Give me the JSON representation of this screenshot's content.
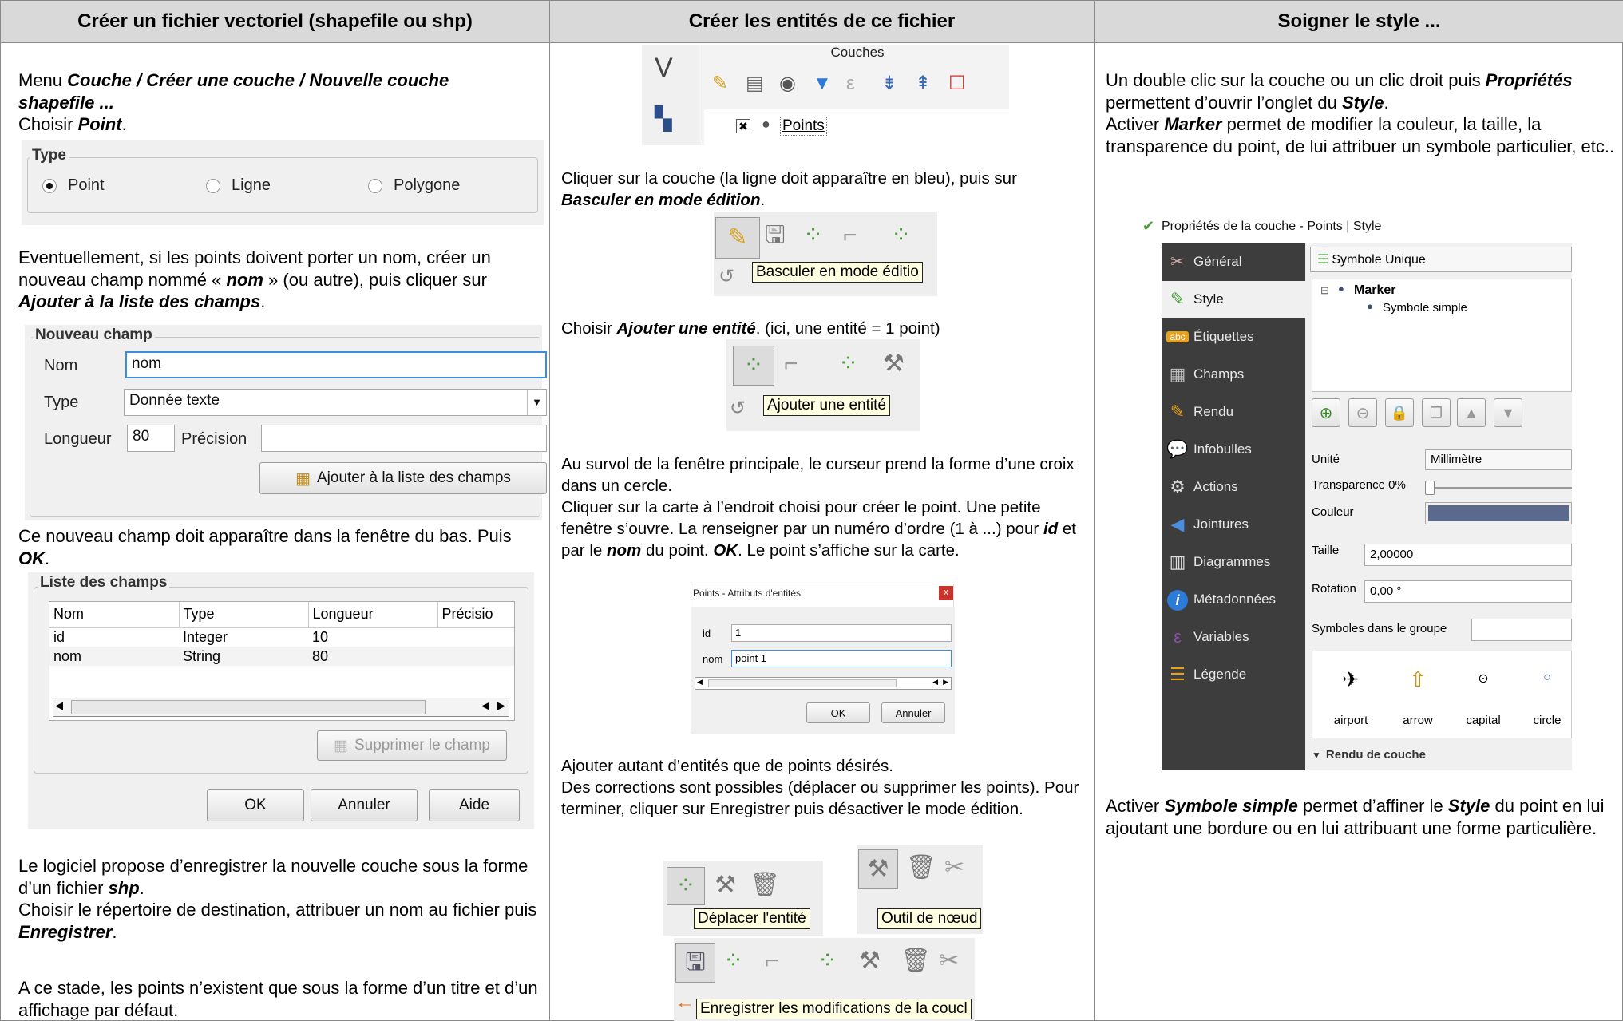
{
  "columns": [
    {
      "title": "Créer un fichier vectoriel (shapefile ou shp)"
    },
    {
      "title": "Créer les entités de ce fichier"
    },
    {
      "title": "Soigner le style ..."
    }
  ],
  "col1": {
    "p1_a": "Menu ",
    "p1_b": "Couche / Créer une couche / Nouvelle couche shapefile ...",
    "p1_c": "Choisir ",
    "p1_d": "Point",
    "p1_e": ".",
    "type_group": {
      "title": "Type",
      "options": [
        "Point",
        "Ligne",
        "Polygone"
      ],
      "selected": "Point"
    },
    "p2_a": "Eventuellement, si les points doivent porter un nom, créer un nouveau champ nommé « ",
    "p2_b": "nom",
    "p2_c": " » (ou autre), puis cliquer sur ",
    "p2_d": "Ajouter à la liste des champs",
    "p2_e": ".",
    "new_field": {
      "title": "Nouveau champ",
      "name_label": "Nom",
      "name_value": "nom",
      "type_label": "Type",
      "type_value": "Donnée texte",
      "length_label": "Longueur",
      "length_value": "80",
      "precision_label": "Précision",
      "precision_value": "",
      "add_button": "Ajouter à la liste des champs"
    },
    "p3_a": "Ce nouveau champ doit apparaître dans la fenêtre du bas. Puis ",
    "p3_b": "OK",
    "p3_c": ".",
    "field_list": {
      "title": "Liste des champs",
      "headers": [
        "Nom",
        "Type",
        "Longueur",
        "Précisio"
      ],
      "rows": [
        [
          "id",
          "Integer",
          "10",
          ""
        ],
        [
          "nom",
          "String",
          "80",
          ""
        ]
      ],
      "delete_button": "Supprimer le champ",
      "ok_button": "OK",
      "cancel_button": "Annuler",
      "help_button": "Aide"
    },
    "p4_a": "Le logiciel propose d’enregistrer la nouvelle couche sous la forme d’un fichier ",
    "p4_b": "shp",
    "p4_c": ".",
    "p4_d": "Choisir le répertoire de destination, attribuer un nom au fichier puis ",
    "p4_e": "Enregistrer",
    "p4_f": ".",
    "p5": "A ce stade, les points n’existent que sous la forme d’un titre et d’un affichage par défaut."
  },
  "col2": {
    "layers_panel": {
      "title": "Couches",
      "layer_name": "Points"
    },
    "p1_a": "Cliquer sur la couche (la ligne doit apparaître en bleu), puis sur ",
    "p1_b": "Basculer en mode édition",
    "p1_c": ".",
    "tip_edit": "Basculer en mode éditio",
    "p2_a": "Choisir ",
    "p2_b": "Ajouter une entité",
    "p2_c": ". (ici, une entité = 1 point)",
    "tip_add": "Ajouter une entité",
    "p3": "Au survol de la fenêtre principale, le curseur prend la forme d’une croix dans un cercle.",
    "p4_a": "Cliquer sur la carte à l’endroit choisi pour créer le point. Une petite fenêtre s’ouvre. La renseigner par un numéro d’ordre (1 à ...) pour ",
    "p4_b": "id",
    "p4_c": " et par le ",
    "p4_d": "nom",
    "p4_e": " du point. ",
    "p4_f": "OK",
    "p4_g": ". Le point s’affiche sur la carte.",
    "attr_dialog": {
      "title": "Points - Attributs d'entités",
      "close": "x",
      "id_label": "id",
      "id_value": "1",
      "nom_label": "nom",
      "nom_value": "point 1",
      "ok": "OK",
      "cancel": "Annuler"
    },
    "p5": "Ajouter autant d’entités que de points désirés.",
    "p6": "Des corrections sont possibles (déplacer ou supprimer les points). Pour terminer, cliquer sur Enregistrer puis désactiver le mode édition.",
    "tip_move": "Déplacer l'entité",
    "tip_node": "Outil de nœud",
    "tip_save": "Enregistrer les modifications de la coucl"
  },
  "col3": {
    "p1_a": "Un double clic sur la couche ou un clic droit puis ",
    "p1_b": "Propriétés",
    "p1_c": " permettent d’ouvrir l’onglet du ",
    "p1_d": "Style",
    "p1_e": ".",
    "p2_a": "Activer ",
    "p2_b": "Marker",
    "p2_c": " permet de modifier la couleur, la taille, la transparence du point, de lui attribuer un symbole particulier, etc..",
    "props": {
      "title": "Propriétés de la couche - Points | Style",
      "sidebar": [
        "Général",
        "Style",
        "Étiquettes",
        "Champs",
        "Rendu",
        "Infobulles",
        "Actions",
        "Jointures",
        "Diagrammes",
        "Métadonnées",
        "Variables",
        "Légende"
      ],
      "selected": "Style",
      "renderer": "Symbole Unique",
      "tree_marker": "Marker",
      "tree_simple": "Symbole simple",
      "unit_label": "Unité",
      "unit_value": "Millimètre",
      "transparency_label": "Transparence 0%",
      "color_label": "Couleur",
      "color_value": "#5a6a8e",
      "size_label": "Taille",
      "size_value": "2,00000",
      "rotation_label": "Rotation",
      "rotation_value": "0,00 °",
      "symbols_label": "Symboles dans le groupe",
      "symbols": [
        "airport",
        "arrow",
        "capital",
        "circle"
      ],
      "layer_render": "Rendu de couche"
    },
    "p3_a": "Activer ",
    "p3_b": "Symbole simple",
    "p3_c": " permet d’affiner le ",
    "p3_d": "Style",
    "p3_e": " du point en lui ajoutant une bordure ou en lui attribuant une forme particulière."
  }
}
